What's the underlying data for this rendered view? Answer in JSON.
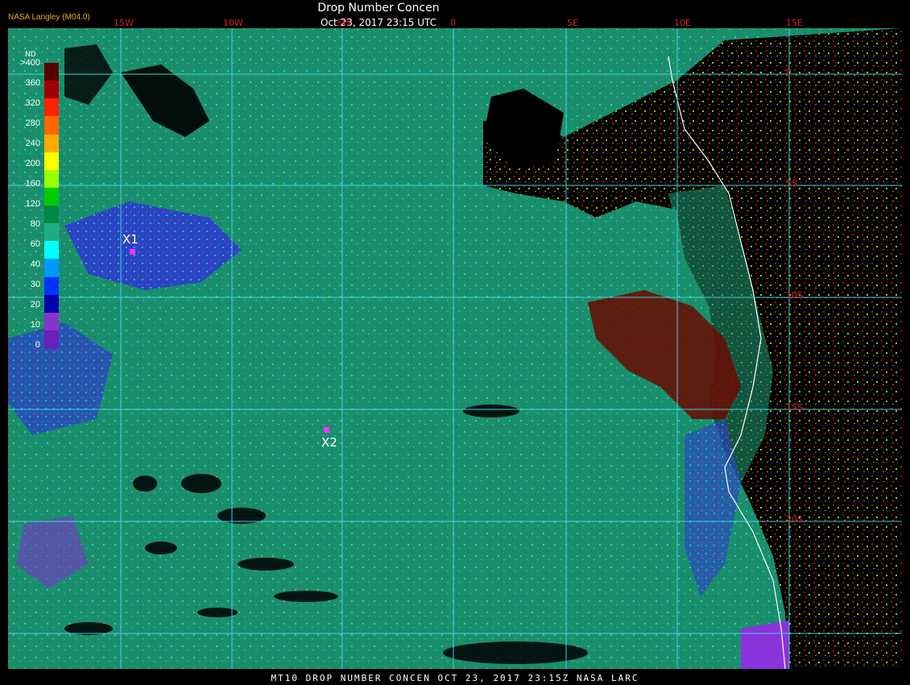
{
  "header": {
    "brand": "NASA Langley (M04.0)",
    "title": "Drop Number Concen",
    "subtitle": "Oct 23, 2017 23:15 UTC"
  },
  "footer": "MT10  DROP NUMBER CONCEN   OCT 23, 2017 23:15Z   NASA LARC",
  "lon_labels": [
    "15W",
    "10W",
    "5W",
    "0",
    "5E",
    "10E",
    "15E"
  ],
  "lat_labels": [
    "0",
    "5S",
    "10S",
    "15S",
    "20S"
  ],
  "legend": {
    "title": "ND",
    "labels": [
      ">400",
      "360",
      "320",
      "280",
      "240",
      "200",
      "160",
      "120",
      "80",
      "60",
      "40",
      "30",
      "20",
      "10",
      "0"
    ],
    "colors": [
      "#5a0000",
      "#a00000",
      "#ff2200",
      "#ff6600",
      "#ffaa00",
      "#ffff00",
      "#99ff00",
      "#00cc00",
      "#008844",
      "#22aa88",
      "#00ffff",
      "#0099ff",
      "#0033ff",
      "#0000aa",
      "#8833cc",
      "#6622bb"
    ]
  },
  "markers": [
    {
      "label": "X1"
    },
    {
      "label": "X2"
    }
  ]
}
